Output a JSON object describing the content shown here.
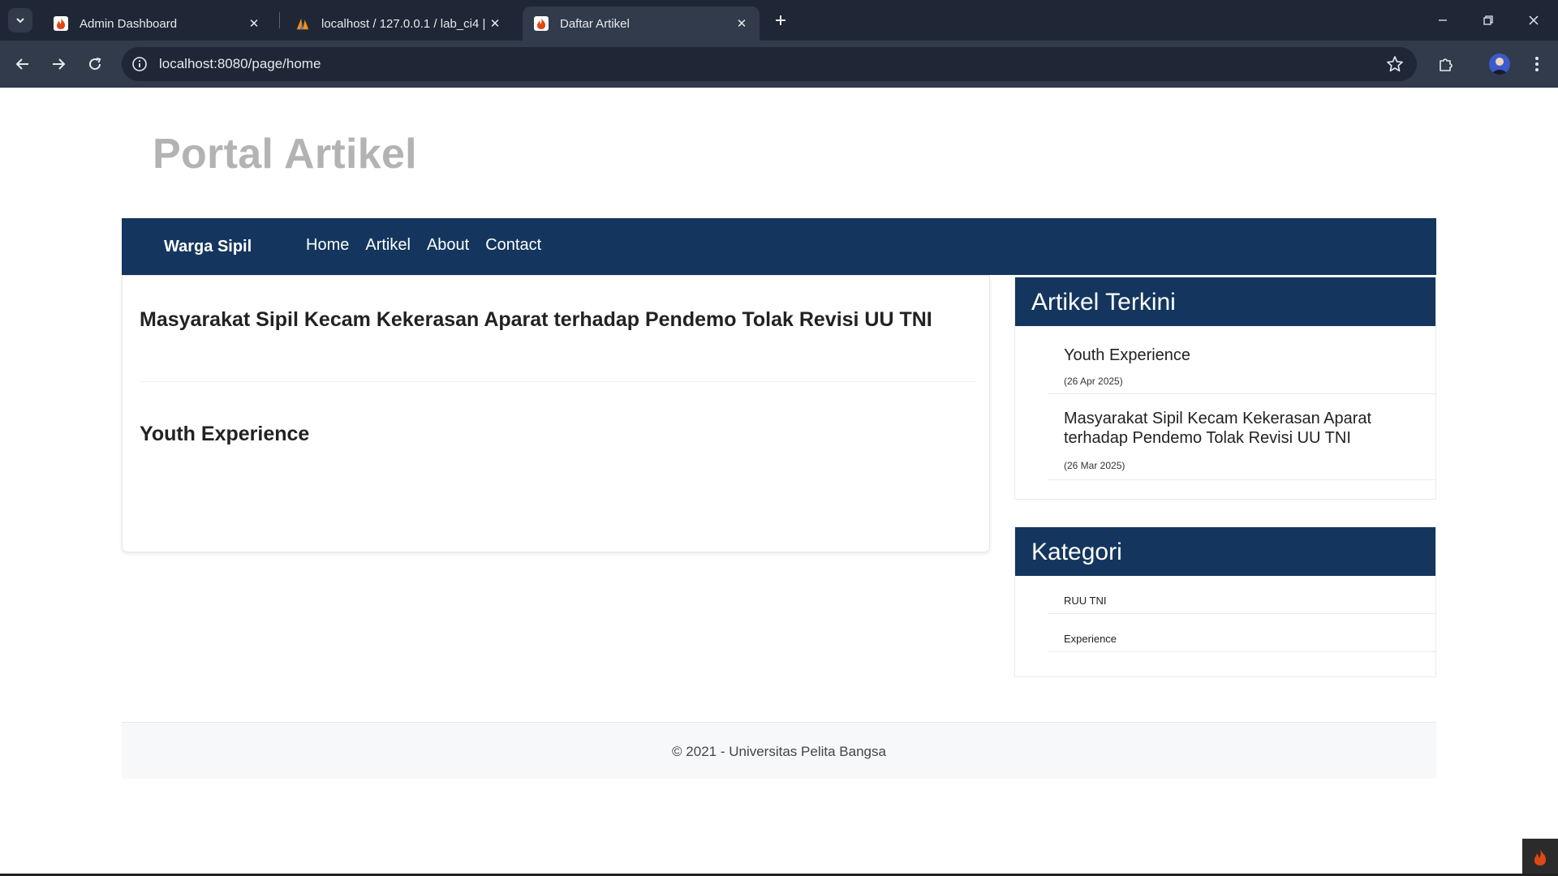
{
  "browser": {
    "tabs": [
      {
        "label": "Admin Dashboard",
        "icon": "codeigniter-flame-icon",
        "active": false
      },
      {
        "label": "localhost / 127.0.0.1 / lab_ci4 | p",
        "icon": "phpmyadmin-sail-icon",
        "active": false
      },
      {
        "label": "Daftar Artikel",
        "icon": "codeigniter-flame-icon",
        "active": true
      }
    ],
    "url": "localhost:8080/page/home"
  },
  "site": {
    "title": "Portal Artikel",
    "brand": "Warga Sipil",
    "nav": [
      {
        "label": "Home"
      },
      {
        "label": "Artikel"
      },
      {
        "label": "About"
      },
      {
        "label": "Contact"
      }
    ]
  },
  "articles": [
    {
      "title": "Masyarakat Sipil Kecam Kekerasan Aparat terhadap Pendemo Tolak Revisi UU TNI"
    },
    {
      "title": "Youth Experience"
    }
  ],
  "sidebar": {
    "recent": {
      "heading": "Artikel Terkini",
      "items": [
        {
          "title_line1": "Youth Experience",
          "title_line2": "",
          "date": "(26 Apr 2025)"
        },
        {
          "title_line1": "Masyarakat Sipil Kecam Kekerasan Aparat",
          "title_line2": "terhadap Pendemo Tolak Revisi UU TNI",
          "date": "(26 Mar 2025)"
        }
      ]
    },
    "categories": {
      "heading": "Kategori",
      "items": [
        {
          "label": "RUU TNI"
        },
        {
          "label": "Experience"
        }
      ]
    }
  },
  "footer": {
    "text": "© 2021 - Universitas Pelita Bangsa"
  },
  "colors": {
    "nav_bg": "#14365e",
    "title_gray": "#b3b3b3",
    "chrome_dark": "#1f2736",
    "chrome_mid": "#323b4b",
    "codeigniter_orange": "#dd4814"
  }
}
